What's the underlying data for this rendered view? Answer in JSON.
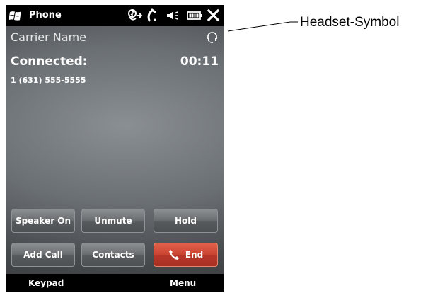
{
  "status_bar": {
    "app_title": "Phone",
    "icons": [
      "windows-start-icon",
      "bluetooth-icon",
      "phone-signal-icon",
      "volume-icon",
      "battery-icon",
      "close-icon"
    ]
  },
  "call": {
    "carrier": "Carrier Name",
    "status": "Connected:",
    "duration": "00:11",
    "number": "1 (631) 555-5555"
  },
  "buttons": {
    "speaker_on": "Speaker On",
    "unmute": "Unmute",
    "hold": "Hold",
    "add_call": "Add Call",
    "contacts": "Contacts",
    "end": "End"
  },
  "softkeys": {
    "left": "Keypad",
    "right": "Menu"
  },
  "annotation": {
    "label": "Headset-Symbol"
  },
  "colors": {
    "end_button": "#c94331",
    "screen_background": "#6a6f73",
    "bar_background": "#000000"
  }
}
